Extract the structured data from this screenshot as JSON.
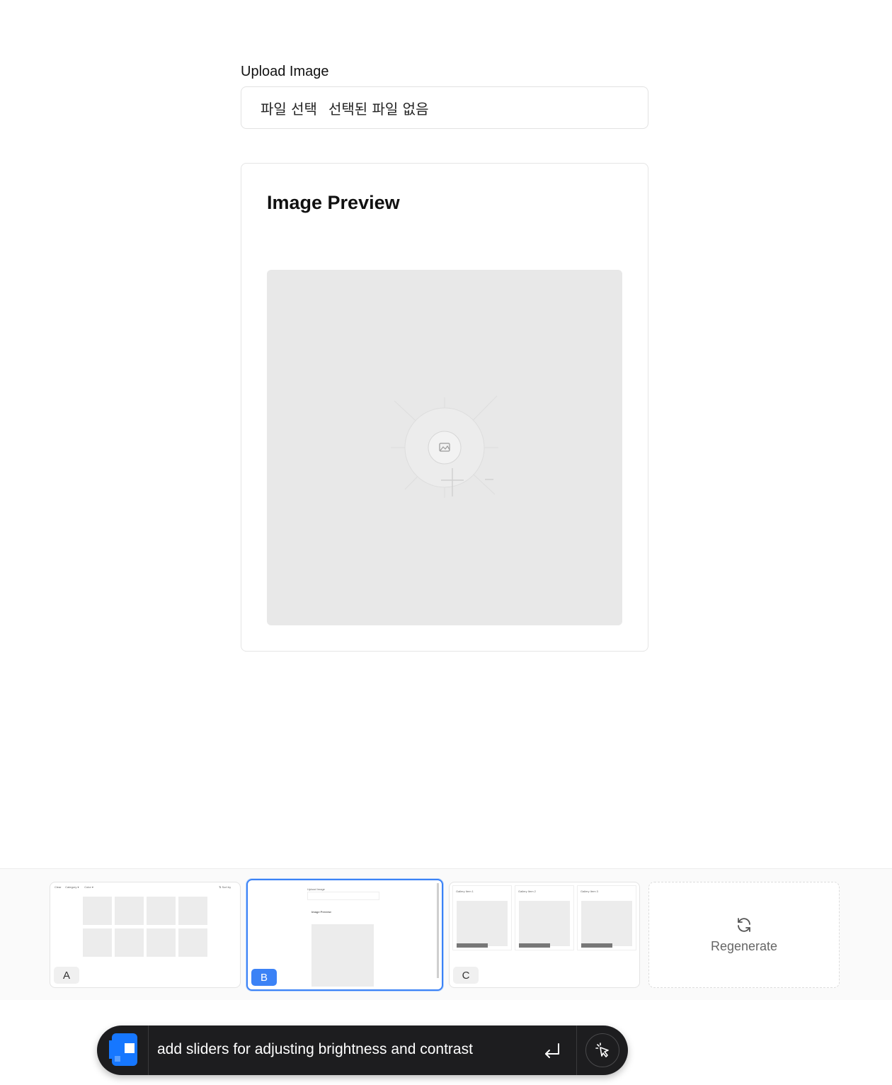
{
  "upload": {
    "label": "Upload Image",
    "choose_button": "파일 선택",
    "status": "선택된 파일 없음"
  },
  "preview": {
    "title": "Image Preview",
    "placeholder_icon": "image-icon"
  },
  "variants": [
    {
      "badge": "A",
      "active": false
    },
    {
      "badge": "B",
      "active": true
    },
    {
      "badge": "C",
      "active": false
    }
  ],
  "regenerate": {
    "label": "Regenerate",
    "icon": "refresh-icon"
  },
  "prompt": {
    "text": "add sliders for adjusting brightness and contrast",
    "submit_icon": "enter-icon",
    "select_icon": "pointer-select-icon"
  },
  "colors": {
    "accent": "#3b82f6",
    "prompt_bg": "#1d1d1f",
    "preview_bg": "#e8e8e8"
  }
}
